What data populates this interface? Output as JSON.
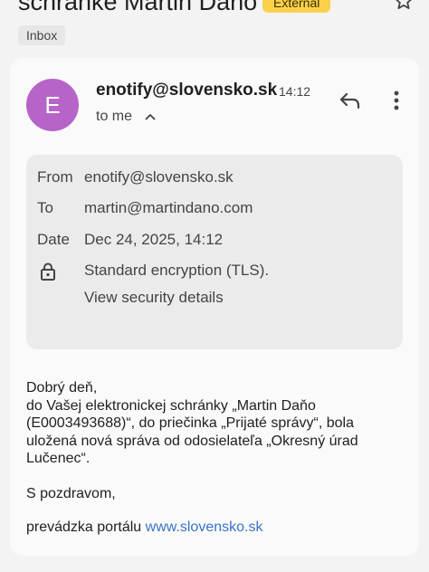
{
  "header": {
    "subject": "schránke Martin Daňo",
    "external_badge": "External",
    "label_chip": "Inbox"
  },
  "message": {
    "avatar_letter": "E",
    "sender": "enotify@slovensko.sk",
    "time": "14:12",
    "to_me": "to me"
  },
  "details": {
    "from_label": "From",
    "from_value": "enotify@slovensko.sk",
    "to_label": "To",
    "to_value": "martin@martindano.com",
    "date_label": "Date",
    "date_value": "Dec 24, 2025, 14:12",
    "encryption_text": "Standard encryption (TLS).",
    "security_link": "View security details"
  },
  "body": {
    "greeting": "Dobrý deň,",
    "paragraph": "do Vašej elektronickej schránky „Martin Daňo (E0003493688)“, do priečinka „Prijaté správy“, bola uložená nová správa od odosielateľa „Okresný úrad Lučenec“.",
    "closing": "S pozdravom,",
    "footer_prefix": "prevádzka portálu ",
    "footer_link": "www.slovensko.sk"
  },
  "colors": {
    "avatar": "#b764c9",
    "badge": "#fbd14b",
    "link": "#3a73c9"
  }
}
